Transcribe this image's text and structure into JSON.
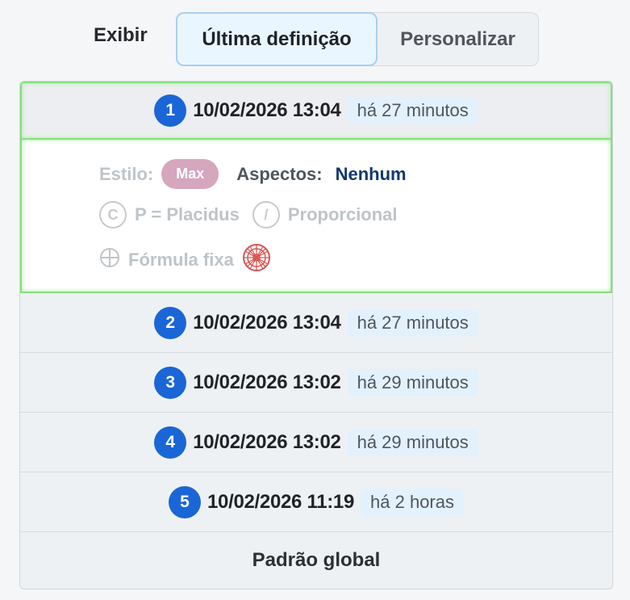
{
  "header": {
    "show_label": "Exibir",
    "tabs": [
      {
        "label": "Última definição",
        "active": true
      },
      {
        "label": "Personalizar",
        "active": false
      }
    ]
  },
  "history": [
    {
      "index": "1",
      "datetime": "10/02/2026 13:04",
      "ago": "há 27 minutos",
      "selected": true
    },
    {
      "index": "2",
      "datetime": "10/02/2026 13:04",
      "ago": "há 27 minutos"
    },
    {
      "index": "3",
      "datetime": "10/02/2026 13:02",
      "ago": "há 29 minutos"
    },
    {
      "index": "4",
      "datetime": "10/02/2026 13:02",
      "ago": "há 29 minutos"
    },
    {
      "index": "5",
      "datetime": "10/02/2026 11:19",
      "ago": "há 2 horas"
    }
  ],
  "details": {
    "style_label": "Estilo:",
    "style_value": "Max",
    "aspects_label": "Aspectos:",
    "aspects_value": "Nenhum",
    "house_system_icon": "C",
    "house_system": "P = Placidus",
    "proportional_icon": "/",
    "proportional": "Proporcional",
    "formula": "Fórmula fixa"
  },
  "footer": {
    "label": "Padrão global"
  },
  "colors": {
    "accent_blue": "#1a66d6",
    "selected_border": "#86e07e",
    "style_badge": "#d5a6bd",
    "aspects_value": "#14376e"
  }
}
